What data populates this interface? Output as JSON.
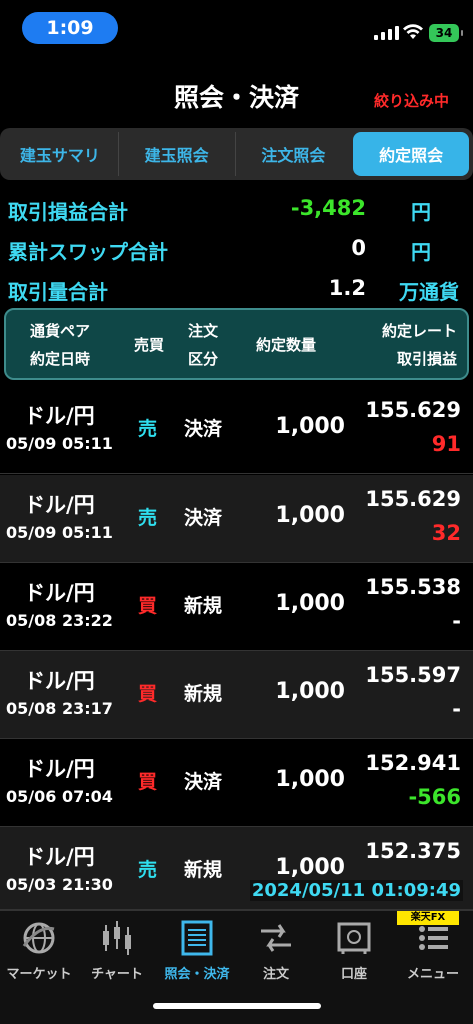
{
  "status": {
    "time": "1:09",
    "battery": "34"
  },
  "header": {
    "title": "照会・決済",
    "filter_label": "絞り込み中"
  },
  "tabs": [
    {
      "label": "建玉サマリ",
      "active": false
    },
    {
      "label": "建玉照会",
      "active": false
    },
    {
      "label": "注文照会",
      "active": false
    },
    {
      "label": "約定照会",
      "active": true
    }
  ],
  "summary": {
    "pnl_total": {
      "label": "取引損益合計",
      "value": "-3,482",
      "unit": "円"
    },
    "swap_total": {
      "label": "累計スワップ合計",
      "value": "0",
      "unit": "円"
    },
    "volume_total": {
      "label": "取引量合計",
      "value": "1.2",
      "unit": "万通貨"
    }
  },
  "table_header": {
    "pair": "通貨ペア",
    "exec_datetime": "約定日時",
    "side": "売買",
    "order_type_1": "注文",
    "order_type_2": "区分",
    "qty": "約定数量",
    "rate": "約定レート",
    "pnl": "取引損益"
  },
  "rows": [
    {
      "pair": "ドル/円",
      "datetime": "05/09 05:11",
      "side": "売",
      "side_type": "sell",
      "kind": "決済",
      "qty": "1,000",
      "rate": "155.629",
      "pnl": "91",
      "pnl_type": "pos"
    },
    {
      "pair": "ドル/円",
      "datetime": "05/09 05:11",
      "side": "売",
      "side_type": "sell",
      "kind": "決済",
      "qty": "1,000",
      "rate": "155.629",
      "pnl": "32",
      "pnl_type": "pos"
    },
    {
      "pair": "ドル/円",
      "datetime": "05/08 23:22",
      "side": "買",
      "side_type": "buy",
      "kind": "新規",
      "qty": "1,000",
      "rate": "155.538",
      "pnl": "-",
      "pnl_type": "none"
    },
    {
      "pair": "ドル/円",
      "datetime": "05/08 23:17",
      "side": "買",
      "side_type": "buy",
      "kind": "新規",
      "qty": "1,000",
      "rate": "155.597",
      "pnl": "-",
      "pnl_type": "none"
    },
    {
      "pair": "ドル/円",
      "datetime": "05/06 07:04",
      "side": "買",
      "side_type": "buy",
      "kind": "決済",
      "qty": "1,000",
      "rate": "152.941",
      "pnl": "-566",
      "pnl_type": "neg"
    },
    {
      "pair": "ドル/円",
      "datetime": "05/03 21:30",
      "side": "売",
      "side_type": "sell",
      "kind": "新規",
      "qty": "1,000",
      "rate": "152.375",
      "pnl": "",
      "pnl_type": "none"
    }
  ],
  "timestamp": "2024/05/11 01:09:49",
  "brand": "楽天FX",
  "nav": [
    {
      "label": "マーケット",
      "icon": "globe-icon"
    },
    {
      "label": "チャート",
      "icon": "candlestick-icon"
    },
    {
      "label": "照会・決済",
      "icon": "document-list-icon",
      "active": true
    },
    {
      "label": "注文",
      "icon": "order-arrows-icon"
    },
    {
      "label": "口座",
      "icon": "safe-icon"
    },
    {
      "label": "メニュー",
      "icon": "menu-icon"
    }
  ],
  "colors": {
    "accent": "#3fd9f2",
    "sell": "#2fe0f0",
    "buy": "#ff2a2a",
    "negative": "#3ce52b",
    "active_tab": "#37b4e8"
  }
}
